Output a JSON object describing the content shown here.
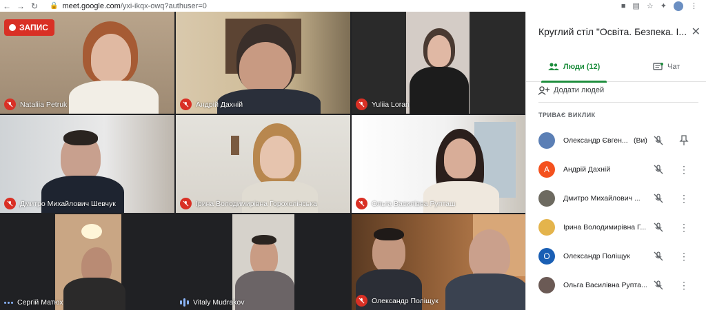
{
  "browser": {
    "url_host": "meet.google.com",
    "url_path": "/yxi-ikqx-owq?authuser=0"
  },
  "recording": {
    "label": "ЗАПИС"
  },
  "tiles": [
    {
      "name": "Nataliia Petruk",
      "status": "muted"
    },
    {
      "name": "Андрій Дахній",
      "status": "muted"
    },
    {
      "name": "Yuliia Loran",
      "status": "muted"
    },
    {
      "name": "Дмитро Михайлович Шевчук",
      "status": "muted"
    },
    {
      "name": "Ірина Володимирівна Горохолінська",
      "status": "muted"
    },
    {
      "name": "Ольга Василівна Рупташ",
      "status": "muted"
    },
    {
      "name": "Сергій Матюх",
      "status": "idle"
    },
    {
      "name": "Vitaly Mudrakov",
      "status": "speaking"
    },
    {
      "name": "Олександр Поліщук",
      "status": "muted"
    }
  ],
  "panel": {
    "title": "Круглий стіл \"Освіта. Безпека. І...",
    "tab_people": "Люди (12)",
    "tab_chat": "Чат",
    "add_people": "Додати людей",
    "section_head": "ТРИВАЄ ВИКЛИК",
    "participants": [
      {
        "name": "Олександр Євген...",
        "you": "(Ви)",
        "avatar_letter": "",
        "avatar_color": "#5b7fb5",
        "action": "pin-icon"
      },
      {
        "name": "Андрій Дахній",
        "you": "",
        "avatar_letter": "А",
        "avatar_color": "#f4511e",
        "action": "more-icon"
      },
      {
        "name": "Дмитро Михайлович ...",
        "you": "",
        "avatar_letter": "",
        "avatar_color": "#6d6a60",
        "action": "more-icon"
      },
      {
        "name": "Ірина Володимирівна Г...",
        "you": "",
        "avatar_letter": "",
        "avatar_color": "#e4b44c",
        "action": "more-icon"
      },
      {
        "name": "Олександр Поліщук",
        "you": "",
        "avatar_letter": "О",
        "avatar_color": "#1a5fb4",
        "action": "more-icon"
      },
      {
        "name": "Ольга Василівна Рупта...",
        "you": "",
        "avatar_letter": "",
        "avatar_color": "#6b5a55",
        "action": "more-icon"
      }
    ]
  }
}
